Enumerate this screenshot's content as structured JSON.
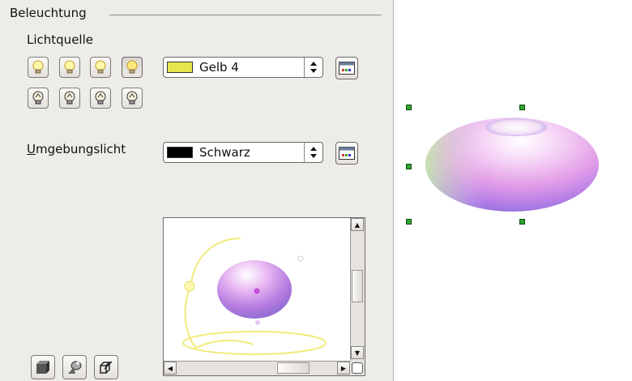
{
  "lighting": {
    "title": "Beleuchtung",
    "light_source_label": "Lichtquelle",
    "light_source_color": {
      "name": "Gelb 4",
      "swatch": "#e6e64c"
    },
    "ambient_label_accel": "U",
    "ambient_label_rest": "mgebungslicht",
    "ambient_color": {
      "name": "Schwarz",
      "swatch": "#000000"
    },
    "light_buttons_row1": [
      "light-1-on",
      "light-2-on",
      "light-3-on",
      "light-4-on-selected"
    ],
    "light_buttons_row2": [
      "light-5-off",
      "light-6-off",
      "light-7-off",
      "light-8-off"
    ]
  },
  "colors": {
    "panel_bg": "#eeece9",
    "handle": "#2fa52f",
    "light_path": "#f0ea7a",
    "torus_purple": "#9a8cf0",
    "torus_pink": "#f2a8ea"
  },
  "bottom_tools": [
    "convert-to-3d-icon",
    "lathe-object-icon",
    "perspective-icon"
  ]
}
